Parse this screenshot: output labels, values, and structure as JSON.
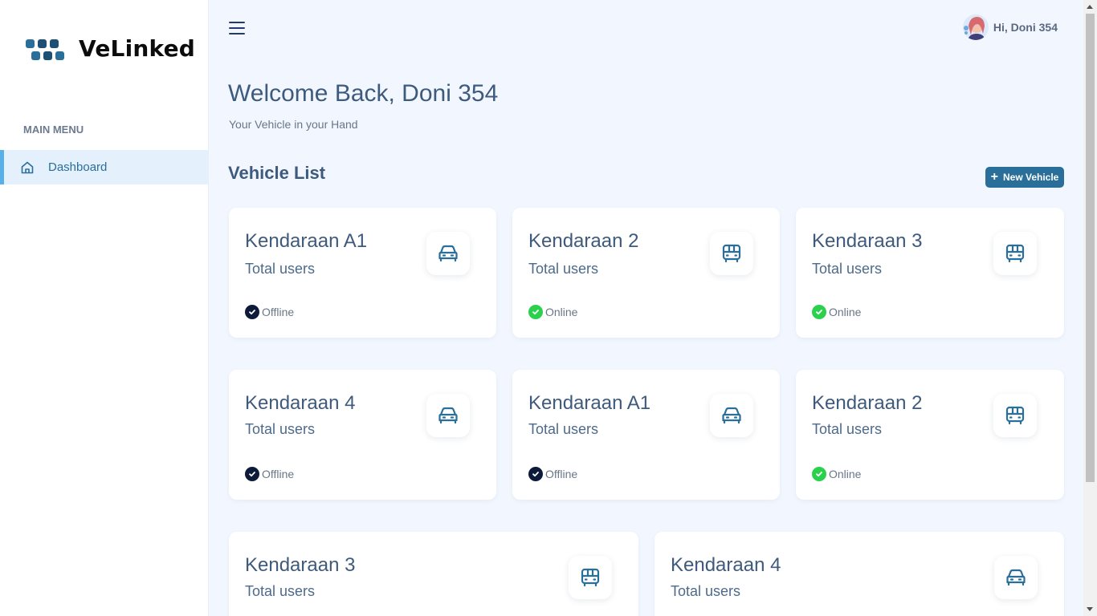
{
  "brand": {
    "name": "VeLinked"
  },
  "sidebar": {
    "menu_title": "MAIN MENU",
    "items": [
      {
        "label": "Dashboard",
        "icon": "home-icon",
        "active": true
      }
    ]
  },
  "header": {
    "greeting": "Hi, Doni 354"
  },
  "main": {
    "title": "Welcome Back, Doni 354",
    "subtitle": "Your Vehicle in your Hand",
    "section_title": "Vehicle List",
    "new_button_label": "New Vehicle"
  },
  "vehicles": [
    {
      "name": "Kendaraan A1",
      "sub": "Total users",
      "icon": "car-icon",
      "status": "Offline"
    },
    {
      "name": "Kendaraan 2",
      "sub": "Total users",
      "icon": "bus-icon",
      "status": "Online"
    },
    {
      "name": "Kendaraan 3",
      "sub": "Total users",
      "icon": "bus-icon",
      "status": "Online"
    },
    {
      "name": "Kendaraan 4",
      "sub": "Total users",
      "icon": "car-icon",
      "status": "Offline"
    },
    {
      "name": "Kendaraan A1",
      "sub": "Total users",
      "icon": "car-icon",
      "status": "Offline"
    },
    {
      "name": "Kendaraan 2",
      "sub": "Total users",
      "icon": "bus-icon",
      "status": "Online"
    },
    {
      "name": "Kendaraan 3",
      "sub": "Total users",
      "icon": "bus-icon",
      "status": ""
    },
    {
      "name": "Kendaraan 4",
      "sub": "Total users",
      "icon": "car-icon",
      "status": ""
    }
  ],
  "colors": {
    "accent": "#2a6f99",
    "online": "#2bd04d",
    "offline": "#0d1a3a",
    "background": "#f2f7ff"
  }
}
